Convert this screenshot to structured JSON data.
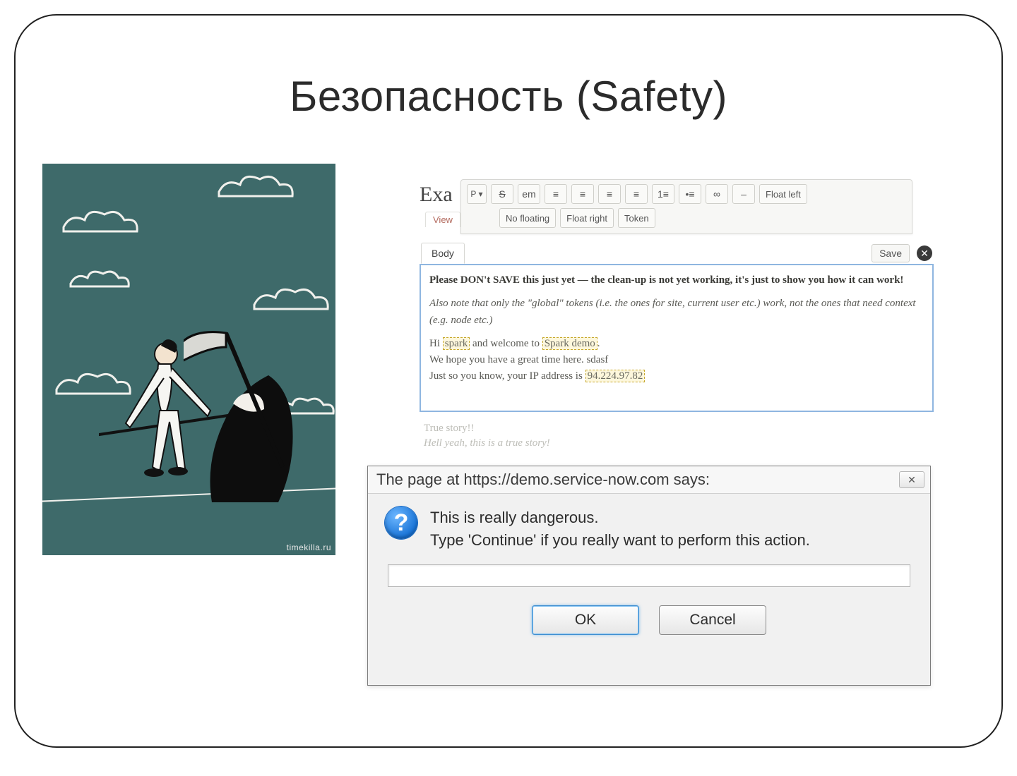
{
  "title": "Безопасность (Safety)",
  "illustration": {
    "watermark": "timekilla.ru"
  },
  "editor": {
    "title_peek": "Exa",
    "view_tab": "View",
    "toolbar": {
      "p_btn": "P ▾",
      "strike": "S",
      "em": "em",
      "float_left": "Float left",
      "no_floating": "No floating",
      "float_right": "Float right",
      "token": "Token"
    },
    "body_tab": "Body",
    "save": "Save",
    "body": {
      "warn": "Please DON't SAVE this just yet — the clean-up is not yet working, it's just to show you how it can work!",
      "note": "Also note that only the \"global\" tokens (i.e. the ones for site, current user etc.) work, not the ones that need context (e.g. node etc.)",
      "hi_pre": "Hi ",
      "hi_tok1": "spark",
      "hi_mid": " and welcome to ",
      "hi_tok2": "Spark demo",
      "hi_post": ".",
      "line2": "We hope you have a great time here. sdasf",
      "line3_pre": "Just so you know, your IP address is ",
      "line3_tok": "94.224.97.82",
      "under1": "True story!!",
      "under2": "Hell yeah, this is a true story!"
    }
  },
  "dialog": {
    "title": "The page at https://demo.service-now.com says:",
    "line1": "This is really dangerous.",
    "line2": "Type 'Continue' if you really want to perform this action.",
    "ok": "OK",
    "cancel": "Cancel"
  }
}
